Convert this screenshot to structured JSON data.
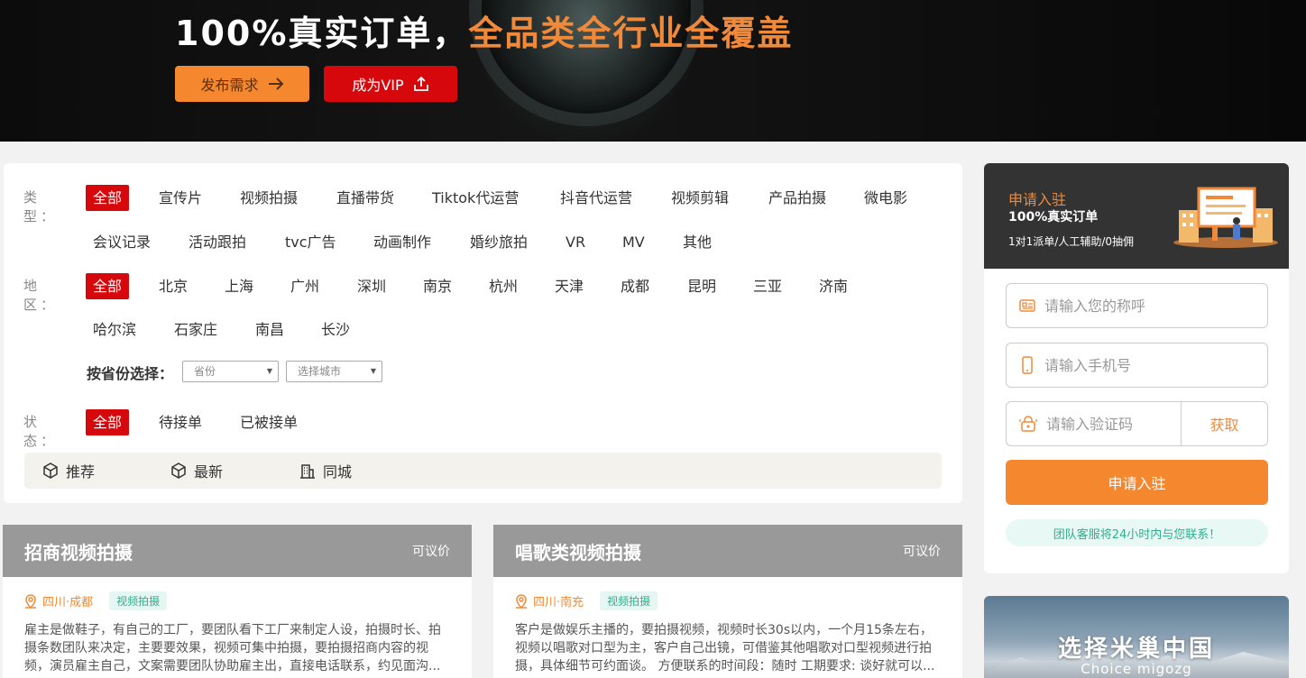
{
  "banner": {
    "headline_white": "100%真实订单，",
    "headline_orange": "全品类全行业全覆盖",
    "publish_label": "发布需求",
    "vip_label": "成为VIP"
  },
  "filters": {
    "type_label": "类 型：",
    "type_options": [
      "全部",
      "宣传片",
      "视频拍摄",
      "直播带货",
      "Tiktok代运营",
      "抖音代运营",
      "视频剪辑",
      "产品拍摄",
      "微电影",
      "会议记录",
      "活动跟拍",
      "tvc广告",
      "动画制作",
      "婚纱旅拍",
      "VR",
      "MV",
      "其他"
    ],
    "region_label": "地 区：",
    "region_options": [
      "全部",
      "北京",
      "上海",
      "广州",
      "深圳",
      "南京",
      "杭州",
      "天津",
      "成都",
      "昆明",
      "三亚",
      "济南",
      "哈尔滨",
      "石家庄",
      "南昌",
      "长沙"
    ],
    "province_label": "按省份选择：",
    "province_select": "省份",
    "city_select": "选择城市",
    "status_label": "状 态：",
    "status_options": [
      "全部",
      "待接单",
      "已被接单"
    ],
    "sort": [
      "推荐",
      "最新",
      "同城"
    ]
  },
  "cards": [
    {
      "title": "招商视频拍摄",
      "price": "可议价",
      "location": "四川·成都",
      "tag": "视频拍摄",
      "desc": "雇主是做鞋子，有自己的工厂，要团队看下工厂来制定人设，拍摄时长、拍摄条数团队来决定，主要要效果，视频可集中拍摄，要拍摄招商内容的视频，演员雇主自己，文案需要团队协助雇主出，直接电话联系，约见面沟..."
    },
    {
      "title": "唱歌类视频拍摄",
      "price": "可议价",
      "location": "四川·南充",
      "tag": "视频拍摄",
      "desc": "客户是做娱乐主播的，要拍摄视频，视频时长30s以内，一个月15条左右，视频以唱歌对口型为主，客户自己出镜，可借鉴其他唱歌对口型视频进行拍摄，具体细节可约面谈。 方便联系的时间段：随时 工期要求: 谈好就可以..."
    }
  ],
  "side": {
    "title": "申请入驻",
    "subtitle": "100%真实订单",
    "desc": "1对1派单/人工辅助/0抽佣",
    "name_placeholder": "请输入您的称呼",
    "phone_placeholder": "请输入手机号",
    "code_placeholder": "请输入验证码",
    "get_code": "获取",
    "apply": "申请入驻",
    "notice": "团队客服将24小时内与您联系！"
  },
  "promo": {
    "title": "选择米巢中国",
    "subtitle": "Choice migozg"
  },
  "colors": {
    "accent_orange": "#f5882f",
    "accent_red": "#d7080c",
    "tag_green": "#2cb08e"
  }
}
